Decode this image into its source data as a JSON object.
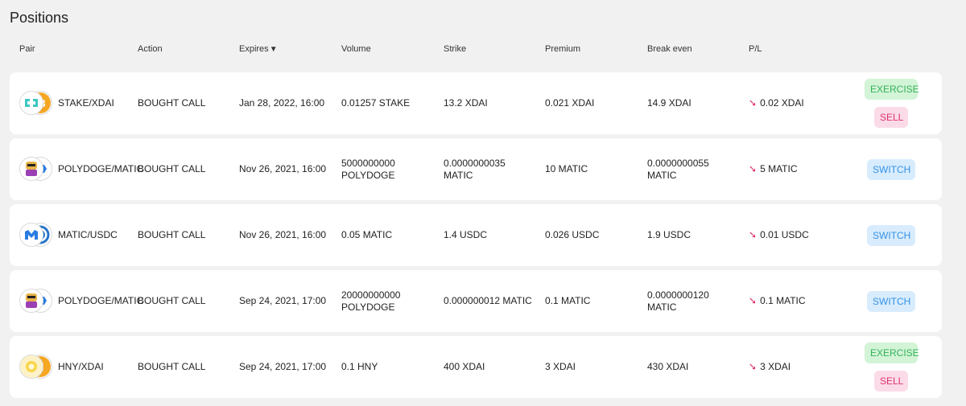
{
  "page": {
    "title": "Positions"
  },
  "columns": {
    "pair": "Pair",
    "action": "Action",
    "expires": "Expires",
    "expires_sort": "▼",
    "volume": "Volume",
    "strike": "Strike",
    "premium": "Premium",
    "break_even": "Break even",
    "pl": "P/L"
  },
  "pl_icon": "trend-down-arrow",
  "colors": {
    "exercise": "#34b25a",
    "sell": "#e0336e",
    "switch": "#3492e6",
    "loss": "#e0336e"
  },
  "rows": [
    {
      "pair": "STAKE/XDAI",
      "icons": [
        "stake-token-icon",
        "xdai-token-icon"
      ],
      "action": "BOUGHT CALL",
      "expires": "Jan 28, 2022, 16:00",
      "volume": "0.01257 STAKE",
      "strike": "13.2 XDAI",
      "premium": "0.021 XDAI",
      "break_even": "14.9 XDAI",
      "pl": "0.02 XDAI",
      "buttons": [
        "EXERCISE",
        "SELL"
      ]
    },
    {
      "pair": "POLYDOGE/MATIC",
      "icons": [
        "polydoge-token-icon",
        "matic-token-icon"
      ],
      "action": "BOUGHT CALL",
      "expires": "Nov 26, 2021, 16:00",
      "volume": "5000000000 POLYDOGE",
      "strike": "0.0000000035 MATIC",
      "premium": "10 MATIC",
      "break_even": "0.0000000055 MATIC",
      "pl": "5 MATIC",
      "buttons": [
        "SWITCH"
      ]
    },
    {
      "pair": "MATIC/USDC",
      "icons": [
        "matic-token-icon",
        "usdc-token-icon"
      ],
      "action": "BOUGHT CALL",
      "expires": "Nov 26, 2021, 16:00",
      "volume": "0.05 MATIC",
      "strike": "1.4 USDC",
      "premium": "0.026 USDC",
      "break_even": "1.9 USDC",
      "pl": "0.01 USDC",
      "buttons": [
        "SWITCH"
      ]
    },
    {
      "pair": "POLYDOGE/MATIC",
      "icons": [
        "polydoge-token-icon",
        "matic-token-icon"
      ],
      "action": "BOUGHT CALL",
      "expires": "Sep 24, 2021, 17:00",
      "volume": "20000000000 POLYDOGE",
      "strike": "0.000000012 MATIC",
      "premium": "0.1 MATIC",
      "break_even": "0.0000000120 MATIC",
      "pl": "0.1 MATIC",
      "buttons": [
        "SWITCH"
      ]
    },
    {
      "pair": "HNY/XDAI",
      "icons": [
        "hny-token-icon",
        "xdai-token-icon"
      ],
      "action": "BOUGHT CALL",
      "expires": "Sep 24, 2021, 17:00",
      "volume": "0.1 HNY",
      "strike": "400 XDAI",
      "premium": "3 XDAI",
      "break_even": "430 XDAI",
      "pl": "3 XDAI",
      "buttons": [
        "EXERCISE",
        "SELL"
      ]
    }
  ]
}
